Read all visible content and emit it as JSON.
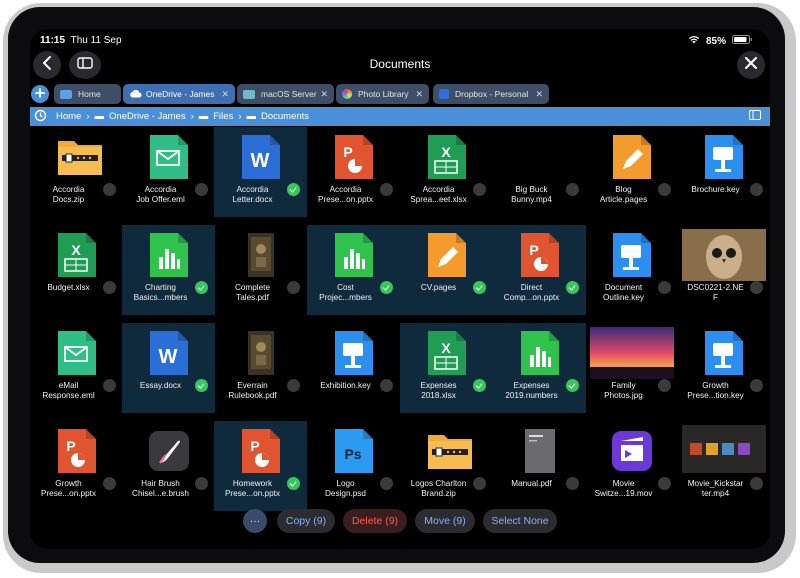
{
  "status": {
    "time": "11:15",
    "date": "Thu 11 Sep",
    "battery": "85%"
  },
  "header": {
    "title": "Documents"
  },
  "tabs": [
    {
      "label": "Home",
      "icon": "folder-icon",
      "active": false,
      "color": "#5aa0e8"
    },
    {
      "label": "OneDrive - James",
      "icon": "cloud-icon",
      "active": true,
      "color": "#ffffff"
    },
    {
      "label": "macOS Server",
      "icon": "monitor-icon",
      "active": false,
      "color": "#6fb9c9"
    },
    {
      "label": "Photo Library",
      "icon": "photos-icon",
      "active": false,
      "color": "#e8a34a"
    },
    {
      "label": "Dropbox - Personal",
      "icon": "dropbox-icon",
      "active": false,
      "color": "#2f6fe0"
    }
  ],
  "path": {
    "items": [
      "Home",
      "OneDrive - James",
      "Files",
      "Documents"
    ]
  },
  "files": [
    {
      "l1": "Accordia",
      "l2": "Docs.zip",
      "icon": "zip-folder-icon",
      "sel": false
    },
    {
      "l1": "Accordia",
      "l2": "Job Offer.eml",
      "icon": "email-icon",
      "sel": false
    },
    {
      "l1": "Accordia",
      "l2": "Letter.docx",
      "icon": "word-icon",
      "sel": true
    },
    {
      "l1": "Accordia",
      "l2": "Prese...on.pptx",
      "icon": "powerpoint-icon",
      "sel": false
    },
    {
      "l1": "Accordia",
      "l2": "Sprea...eet.xlsx",
      "icon": "excel-icon",
      "sel": false
    },
    {
      "l1": "Big Buck",
      "l2": "Bunny.mp4",
      "icon": "video-blank-icon",
      "sel": false
    },
    {
      "l1": "Blog",
      "l2": "Article.pages",
      "icon": "pages-icon",
      "sel": false
    },
    {
      "l1": "Brochure.key",
      "l2": "",
      "icon": "keynote-icon",
      "sel": false
    },
    {
      "l1": "Budget.xlsx",
      "l2": "",
      "icon": "excel-icon",
      "sel": false
    },
    {
      "l1": "Charting",
      "l2": "Basics...mbers",
      "icon": "numbers-icon",
      "sel": true
    },
    {
      "l1": "Complete",
      "l2": "Tales.pdf",
      "icon": "pdf-book-icon",
      "sel": false
    },
    {
      "l1": "Cost",
      "l2": "Projec...mbers",
      "icon": "numbers-icon",
      "sel": true
    },
    {
      "l1": "CV.pages",
      "l2": "",
      "icon": "pages-icon",
      "sel": true
    },
    {
      "l1": "Direct",
      "l2": "Comp...on.pptx",
      "icon": "powerpoint-icon",
      "sel": true
    },
    {
      "l1": "Document",
      "l2": "Outline.key",
      "icon": "keynote-icon",
      "sel": false
    },
    {
      "l1": "DSC0221-2.NE",
      "l2": "F",
      "icon": "owl-photo-icon",
      "sel": false
    },
    {
      "l1": "eMail",
      "l2": "Response.eml",
      "icon": "email-icon",
      "sel": false
    },
    {
      "l1": "Essay.docx",
      "l2": "",
      "icon": "word-icon",
      "sel": true
    },
    {
      "l1": "Everrain",
      "l2": "Rulebook.pdf",
      "icon": "pdf-book-icon",
      "sel": false
    },
    {
      "l1": "Exhibition.key",
      "l2": "",
      "icon": "keynote-icon",
      "sel": false
    },
    {
      "l1": "Expenses",
      "l2": "2018.xlsx",
      "icon": "excel-icon",
      "sel": true
    },
    {
      "l1": "Expenses",
      "l2": "2019.numbers",
      "icon": "numbers-icon",
      "sel": true
    },
    {
      "l1": "Family",
      "l2": "Photos.jpg",
      "icon": "sunset-photo-icon",
      "sel": false
    },
    {
      "l1": "Growth",
      "l2": "Prese...tion.key",
      "icon": "keynote-icon",
      "sel": false
    },
    {
      "l1": "Growth",
      "l2": "Prese...on.pptx",
      "icon": "powerpoint-icon",
      "sel": false
    },
    {
      "l1": "Hair Brush",
      "l2": "Chisel...e.brush",
      "icon": "brush-icon",
      "sel": false
    },
    {
      "l1": "Homework",
      "l2": "Prese...on.pptx",
      "icon": "powerpoint-icon",
      "sel": true
    },
    {
      "l1": "Logo",
      "l2": "Design.psd",
      "icon": "photoshop-icon",
      "sel": false
    },
    {
      "l1": "Logos Charlton",
      "l2": "Brand.zip",
      "icon": "zip-folder-icon",
      "sel": false
    },
    {
      "l1": "Manual.pdf",
      "l2": "",
      "icon": "pdf-manual-icon",
      "sel": false
    },
    {
      "l1": "Movie",
      "l2": "Switze...19.mov",
      "icon": "imovie-icon",
      "sel": false
    },
    {
      "l1": "Movie_Kickstar",
      "l2": "ter.mp4",
      "icon": "video-thumb-icon",
      "sel": false
    }
  ],
  "toolbar": {
    "more": "···",
    "copy": "Copy (9)",
    "delete": "Delete (9)",
    "move": "Move (9)",
    "select_none": "Select None"
  }
}
